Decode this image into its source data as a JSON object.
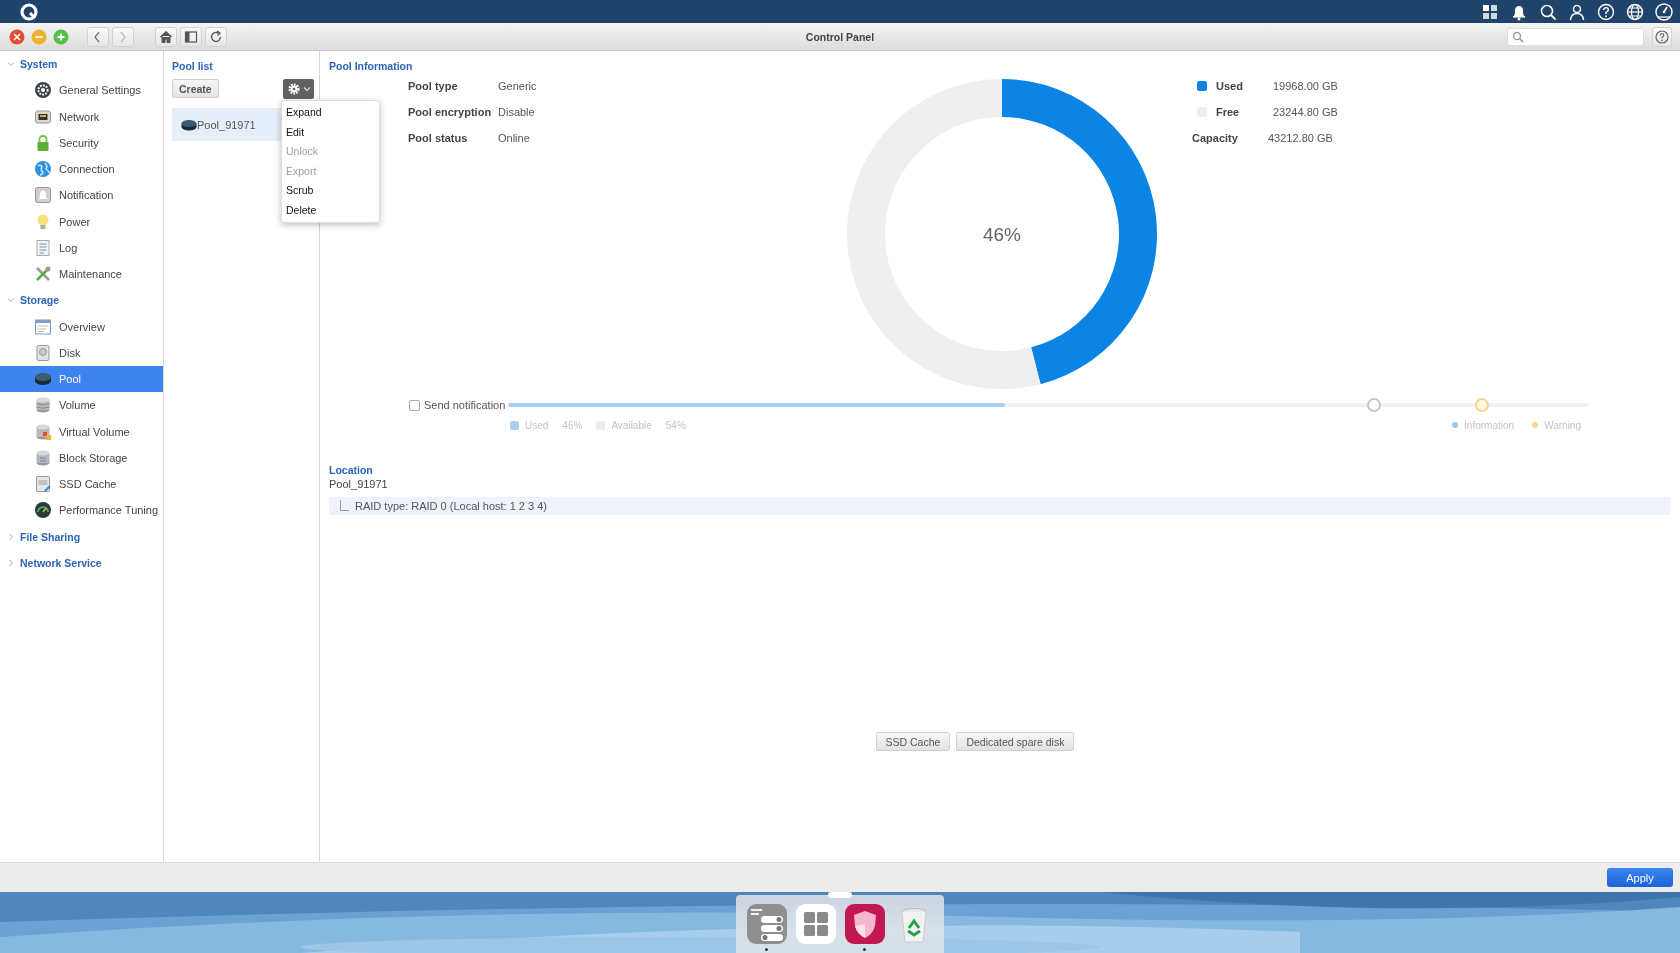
{
  "window": {
    "title": "Control Panel"
  },
  "sidebar": {
    "sections": [
      {
        "label": "System",
        "expanded": true,
        "children": [
          {
            "label": "General Settings",
            "selected": false
          },
          {
            "label": "Network",
            "selected": false
          },
          {
            "label": "Security",
            "selected": false
          },
          {
            "label": "Connection",
            "selected": false
          },
          {
            "label": "Notification",
            "selected": false
          },
          {
            "label": "Power",
            "selected": false
          },
          {
            "label": "Log",
            "selected": false
          },
          {
            "label": "Maintenance",
            "selected": false
          }
        ]
      },
      {
        "label": "Storage",
        "expanded": true,
        "children": [
          {
            "label": "Overview",
            "selected": false
          },
          {
            "label": "Disk",
            "selected": false
          },
          {
            "label": "Pool",
            "selected": true
          },
          {
            "label": "Volume",
            "selected": false
          },
          {
            "label": "Virtual Volume",
            "selected": false
          },
          {
            "label": "Block Storage",
            "selected": false
          },
          {
            "label": "SSD Cache",
            "selected": false
          },
          {
            "label": "Performance Tuning",
            "selected": false
          }
        ]
      },
      {
        "label": "File Sharing",
        "expanded": false
      },
      {
        "label": "Network Service",
        "expanded": false
      }
    ]
  },
  "pool_list": {
    "title": "Pool list",
    "create_button": "Create",
    "pools": [
      {
        "name": "Pool_91971",
        "selected": true
      }
    ],
    "action_menu": {
      "open": true,
      "items": [
        {
          "label": "Expand",
          "disabled": false
        },
        {
          "label": "Edit",
          "disabled": false
        },
        {
          "label": "Unlock",
          "disabled": true
        },
        {
          "label": "Export",
          "disabled": true
        },
        {
          "label": "Scrub",
          "disabled": false
        },
        {
          "label": "Delete",
          "disabled": false
        }
      ]
    }
  },
  "pool_information": {
    "title": "Pool Information",
    "fields": [
      {
        "label": "Pool type",
        "value": "Generic"
      },
      {
        "label": "Pool encryption",
        "value": "Disable"
      },
      {
        "label": "Pool status",
        "value": "Online"
      }
    ],
    "usage": {
      "percent_label": "46%",
      "chart_data": {
        "type": "donut",
        "categories": [
          "Used",
          "Free"
        ],
        "values": [
          46,
          54
        ]
      }
    },
    "legend": [
      {
        "value": "19968.00 GB",
        "color": "#0b84e4"
      },
      {
        "value": "23244.80 GB",
        "color": "#efefef"
      }
    ],
    "capacity": {
      "label": "Capacity",
      "value": "43212.80 GB"
    }
  },
  "notification": {
    "label": "Send notification",
    "checked": false,
    "usage_bar": {
      "level": 0.46
    },
    "usage_legend": [
      {
        "label": "Used",
        "value": "46%",
        "color": "#a9d0f1"
      },
      {
        "label": "Available",
        "value": "54%",
        "color": "#ededed"
      }
    ],
    "threshold_handles": [
      {
        "level": 0.8
      },
      {
        "level": 0.9
      }
    ],
    "thresholds": [
      {
        "label": "Information",
        "color": "#9cc8ee"
      },
      {
        "label": "Warning",
        "color": "#f6d88c"
      }
    ]
  },
  "location": {
    "title": "Location",
    "pool": "Pool_91971",
    "raid": "RAID type: RAID 0 (Local host: 1 2 3 4)"
  },
  "buttons": [
    "SSD Cache",
    "Dedicated spare disk"
  ],
  "apply_button": "Apply",
  "dock": [
    {
      "running": true
    },
    {
      "running": false
    },
    {
      "running": true
    },
    {
      "running": false
    }
  ]
}
